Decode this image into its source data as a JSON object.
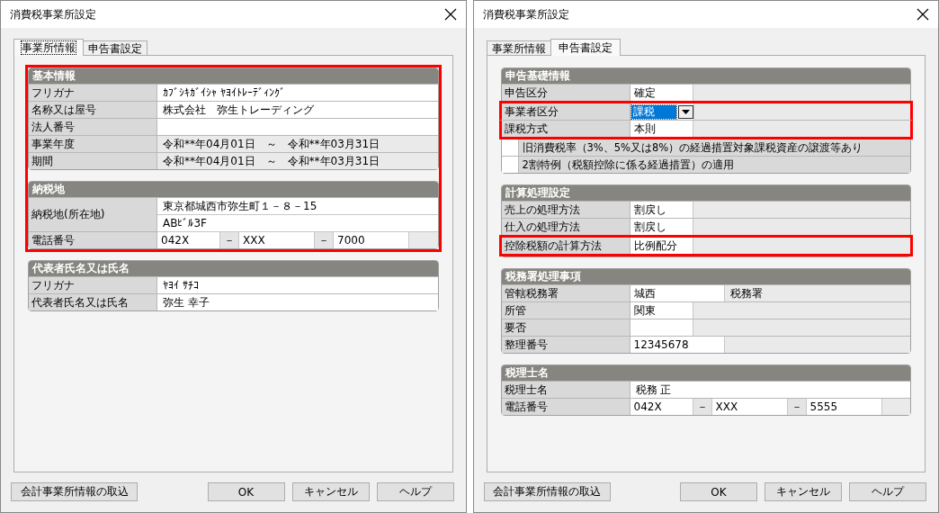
{
  "dialogs": [
    {
      "title": "消費税事業所設定",
      "tabs": [
        {
          "label": "事業所情報",
          "selected": true,
          "focused": true
        },
        {
          "label": "申告書設定",
          "selected": false,
          "focused": false
        }
      ],
      "sections": [
        {
          "title": "基本情報",
          "highlighted": true,
          "rows": [
            {
              "kind": "text",
              "label": "フリガナ",
              "values": [
                "ｶﾌﾞｼｷｶﾞｲｼｬ ﾔﾖｲﾄﾚｰﾃﾞｨﾝｸﾞ"
              ],
              "highlighted": false
            },
            {
              "kind": "text",
              "label": "名称又は屋号",
              "values": [
                "株式会社　弥生トレーディング"
              ],
              "highlighted": false
            },
            {
              "kind": "text",
              "label": "法人番号",
              "values": [],
              "highlighted": false
            },
            {
              "kind": "static",
              "label": "事業年度",
              "values": [
                "令和**年04月01日　～　令和**年03月31日"
              ],
              "highlighted": false
            },
            {
              "kind": "static",
              "label": "期間",
              "values": [
                "令和**年04月01日　～　令和**年03月31日"
              ],
              "highlighted": false
            }
          ]
        },
        {
          "title": "納税地",
          "highlighted": true,
          "rows": [
            {
              "kind": "multiline",
              "label": "納税地(所在地)",
              "values": [
                "東京都城西市弥生町１－８－15",
                "ABﾋﾞﾙ3F"
              ],
              "highlighted": false
            },
            {
              "kind": "phone",
              "label": "電話番号",
              "values": [
                "042X",
                "XXX",
                "7000"
              ],
              "separators": [
                "－",
                "－"
              ],
              "highlighted": false
            }
          ]
        },
        {
          "title": "代表者氏名又は氏名",
          "highlighted": false,
          "rows": [
            {
              "kind": "text",
              "label": "フリガナ",
              "values": [
                "ﾔﾖｲ ｻﾁｺ"
              ],
              "highlighted": false
            },
            {
              "kind": "text",
              "label": "代表者氏名又は氏名",
              "values": [
                "弥生 幸子"
              ],
              "highlighted": false
            }
          ]
        }
      ],
      "buttons": [
        "会計事業所情報の取込",
        "OK",
        "キャンセル",
        "ヘルプ"
      ]
    },
    {
      "title": "消費税事業所設定",
      "tabs": [
        {
          "label": "事業所情報",
          "selected": false,
          "focused": false
        },
        {
          "label": "申告書設定",
          "selected": true,
          "focused": false
        }
      ],
      "sections": [
        {
          "title": "申告基礎情報",
          "highlighted": false,
          "rows": [
            {
              "kind": "short",
              "label": "申告区分",
              "values": [
                "確定"
              ],
              "highlighted": false
            },
            {
              "kind": "combo",
              "label": "事業者区分",
              "values": [
                "課税"
              ],
              "selected": true,
              "highlighted": true
            },
            {
              "kind": "short",
              "label": "課税方式",
              "values": [
                "本則"
              ],
              "highlighted": true
            },
            {
              "kind": "check",
              "label": "旧消費税率（3%、5%又は8%）の経過措置対象課税資産の譲渡等あり",
              "checked": false,
              "highlighted": false
            },
            {
              "kind": "check",
              "label": "2割特例（税額控除に係る経過措置）の適用",
              "checked": false,
              "highlighted": false
            }
          ]
        },
        {
          "title": "計算処理設定",
          "highlighted": false,
          "rows": [
            {
              "kind": "short",
              "label": "売上の処理方法",
              "values": [
                "割戻し"
              ],
              "highlighted": false
            },
            {
              "kind": "short",
              "label": "仕入の処理方法",
              "values": [
                "割戻し"
              ],
              "highlighted": false
            },
            {
              "kind": "short",
              "label": "控除税額の計算方法",
              "values": [
                "比例配分"
              ],
              "highlighted": true
            }
          ]
        },
        {
          "title": "税務署処理事項",
          "highlighted": false,
          "rows": [
            {
              "kind": "medium",
              "label": "管轄税務署",
              "values": [
                "城西",
                "税務署"
              ],
              "highlighted": false
            },
            {
              "kind": "short",
              "label": "所管",
              "values": [
                "関東"
              ],
              "highlighted": false
            },
            {
              "kind": "short",
              "label": "要否",
              "values": [],
              "highlighted": false
            },
            {
              "kind": "medium",
              "label": "整理番号",
              "values": [
                "12345678"
              ],
              "highlighted": false
            }
          ]
        },
        {
          "title": "税理士名",
          "highlighted": false,
          "rows": [
            {
              "kind": "text",
              "label": "税理士名",
              "values": [
                "税務 正"
              ],
              "highlighted": false
            },
            {
              "kind": "phone",
              "label": "電話番号",
              "values": [
                "042X",
                "XXX",
                "5555"
              ],
              "separators": [
                "－",
                "－"
              ],
              "highlighted": false
            }
          ]
        }
      ],
      "buttons": [
        "会計事業所情報の取込",
        "OK",
        "キャンセル",
        "ヘルプ"
      ]
    }
  ]
}
